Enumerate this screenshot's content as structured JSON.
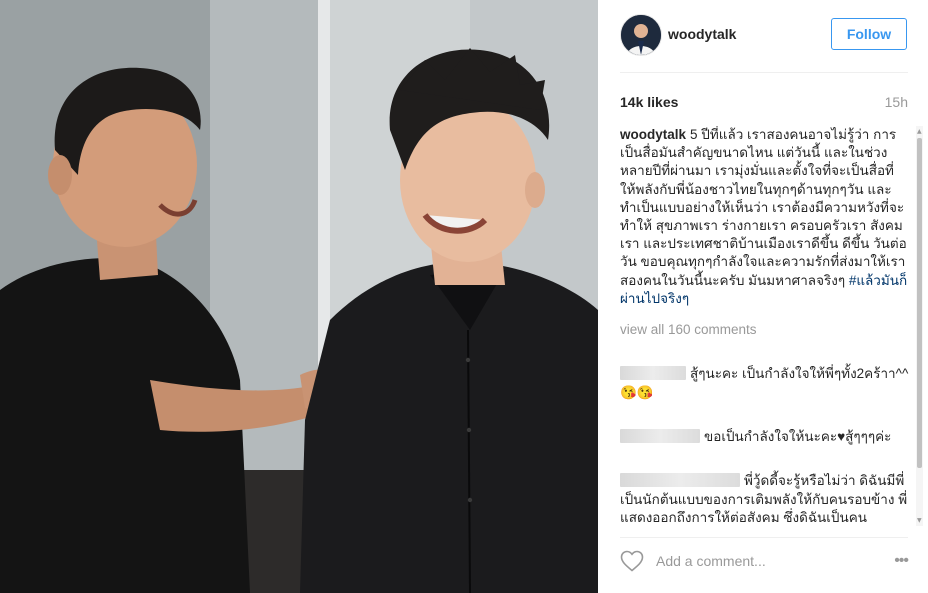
{
  "post": {
    "username": "woodytalk",
    "follow_label": "Follow",
    "likes": "14k likes",
    "time": "15h",
    "caption_user": "woodytalk",
    "caption_text": "5 ปีที่แล้ว เราสองคนอาจไม่รู้ว่า การเป็นสื่อมันสำคัญขนาดไหน แต่วันนี้ และในช่วงหลายปีที่ผ่านมา เรามุ่งมั่นและตั้งใจที่จะเป็นสื่อที่ให้พลังกับพี่น้องชาวไทยในทุกๆด้านทุกๆวัน และทำเป็นแบบอย่างให้เห็นว่า เราต้องมีความหวังที่จะทำให้ สุขภาพเรา ร่างกายเรา ครอบครัวเรา สังคมเรา และประเทศชาติบ้านเมืองเราดีขึ้น ดีขึ้น วันต่อวัน ขอบคุณทุกๆกำลังใจและความรักที่ส่งมาให้เราสองคนในวันนี้นะครับ มันมหาศาลจริงๆ ",
    "caption_hashtag": "#แล้วมันก็ผ่านไปจริงๆ",
    "view_all": "view all 160 comments",
    "comments": [
      {
        "text": "สู้ๆนะคะ เป็นกำลังใจให้พี่ๆทั้ง2คร้าา^^ 😘😘"
      },
      {
        "text": "ขอเป็นกำลังใจให้นะคะ",
        "trail": "สู้ๆๆๆค่ะ"
      },
      {
        "text": "พี่วู้ดดี้จะรู้หรือไม่ว่า ดิฉันมีพี่เป็นนักต้นแบบของการเติมพลังให้กับคนรอบข้าง พี่แสดงออกถึงการให้ต่อสังคม ซึ่งดิฉันเป็นคนธรรมดาที่สัมผัสได้ "
      }
    ],
    "add_comment_placeholder": "Add a comment...",
    "more_label": "•••"
  },
  "colors": {
    "accent": "#3897f0",
    "hashtag": "#003569",
    "muted": "#999999",
    "heart": "#ed4956"
  },
  "icons": [
    "heart-outline-icon",
    "more-options-icon",
    "red-heart-icon",
    "black-heart-icon"
  ]
}
